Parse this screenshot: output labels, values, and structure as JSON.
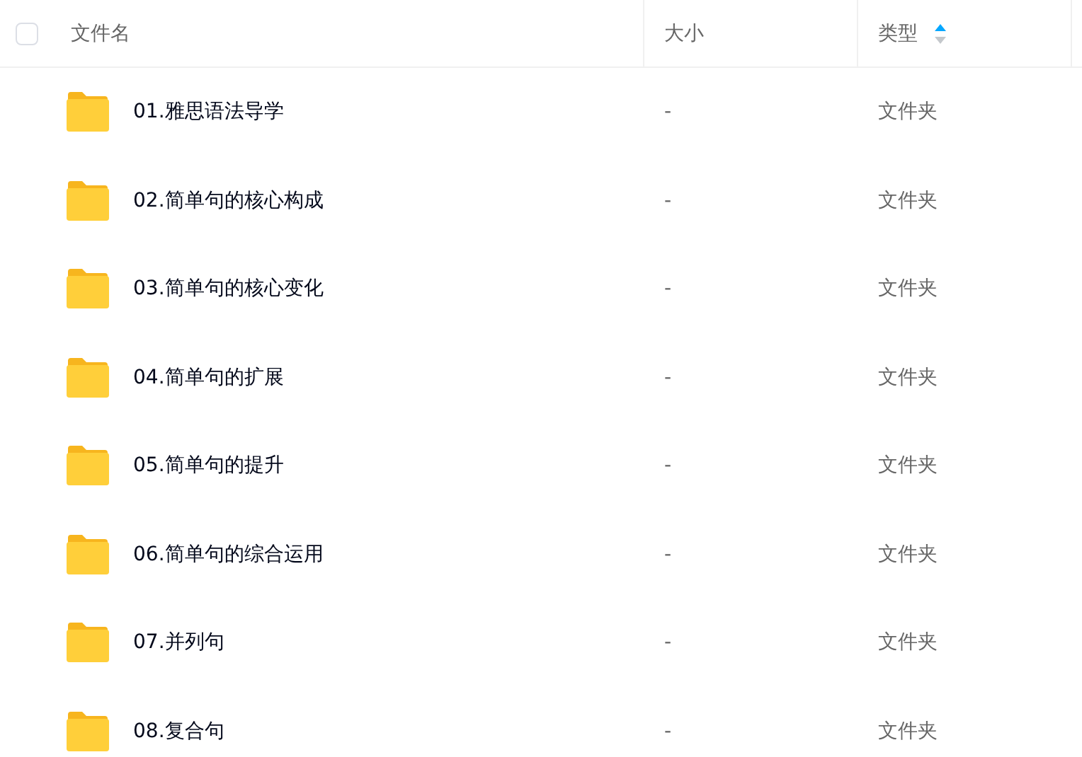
{
  "header": {
    "select_all": {
      "checked": false
    },
    "columns": [
      {
        "label": "文件名",
        "sorted": false
      },
      {
        "label": "大小",
        "sorted": false
      },
      {
        "label": "类型",
        "sorted": true,
        "ascending": true
      }
    ]
  },
  "rows": [
    {
      "name": "01.雅思语法导学",
      "size": "-",
      "type": "文件夹"
    },
    {
      "name": "02.简单句的核心构成",
      "size": "-",
      "type": "文件夹"
    },
    {
      "name": "03.简单句的核心变化",
      "size": "-",
      "type": "文件夹"
    },
    {
      "name": "04.简单句的扩展",
      "size": "-",
      "type": "文件夹"
    },
    {
      "name": "05.简单句的提升",
      "size": "-",
      "type": "文件夹"
    },
    {
      "name": "06.简单句的综合运用",
      "size": "-",
      "type": "文件夹"
    },
    {
      "name": "07.并列句",
      "size": "-",
      "type": "文件夹"
    },
    {
      "name": "08.复合句",
      "size": "-",
      "type": "文件夹"
    }
  ]
}
